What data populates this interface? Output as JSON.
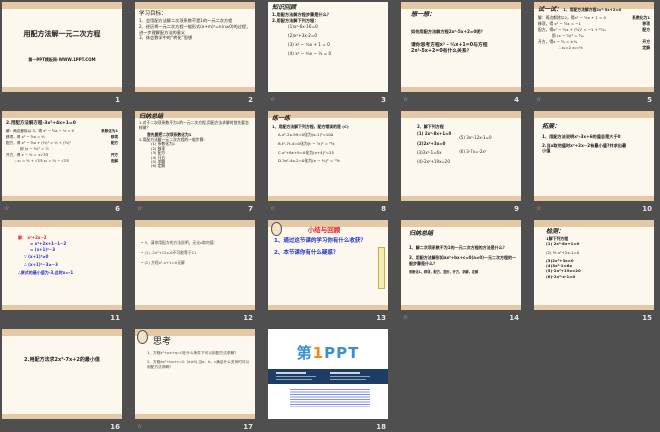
{
  "slides": [
    {
      "number": "1",
      "title": "用配方法解一元二次方程",
      "footer": "第一PPT模板网-WWW.1PPT.COM"
    },
    {
      "number": "2",
      "heading": "学习目标：",
      "lines": [
        "1、会用配方法解二次项系数不是1的一元二次方程",
        "2、经历将一元二次方程一般形式(x+m)²=n(n≥0)的过程，进一步理解配方法的意义",
        "3、体会数学中的“转化”思想"
      ]
    },
    {
      "number": "3",
      "heading": "知识回顾",
      "lines": [
        "1.用配方法解方程步骤是什么？",
        "2.用配方法解下列方程：",
        "(1)x²-6x-16=0",
        "(2)x²+3x-2=0",
        "(3) x² − ⁵⁄₂x + 1 = 0",
        "(4) x² − ⁴⁄₃x − ⅓ = 0"
      ]
    },
    {
      "number": "4",
      "heading": "想一想：",
      "lines": [
        "如何用配方法解方程2x²-5x+2=0呢？",
        "请你思考方程x² - ⁵⁄₂x+1=0与方程2x²-5x+2=0有什么关系？"
      ]
    },
    {
      "number": "5",
      "heading": "试一试：",
      "subheading": "1、用配方法解方程2x²-5x+2=0",
      "rows": [
        {
          "text": "解：两边都除以2，得x² − ⁵⁄₂x + 1 = 0",
          "note": "系数化为1"
        },
        {
          "text": "移项，得 x² − ⁵⁄₂x = −1",
          "note": "移项"
        },
        {
          "text": "配方，得x² − ⁵⁄₂x + (⁵⁄₄)² = −1 + ²⁵⁄₁₆",
          "note": "配方"
        },
        {
          "text": "即 (x − ⁵⁄₄)² = ⁹⁄₁₆",
          "note": ""
        },
        {
          "text": "开方，得x − ⁵⁄₄ = ±¾",
          "note": "开方"
        },
        {
          "text": "∴ x₁=2  x₂=½",
          "note": "定解"
        }
      ]
    },
    {
      "number": "6",
      "heading": "2.用配方法解方程-3x²+4x+1=0",
      "rows": [
        {
          "text": "解：两边都除以-3，得 x² − ⁴⁄₃x − ⅓ = 0",
          "note": "系数化为1"
        },
        {
          "text": "移项，得 x² − ⁴⁄₃x = ⅓",
          "note": "移项"
        },
        {
          "text": "配方，得 x² − ⁴⁄₃x + (⅔)² = ⅓ + (⅔)²",
          "note": "配方"
        },
        {
          "text": "即 (x − ⅔)² = ⁷⁄₉",
          "note": ""
        },
        {
          "text": "开方，得 x − ⅔ = ±√7⁄3",
          "note": "开方"
        },
        {
          "text": "∴ x₁ = ⅔ + √7⁄3  x₂ = ⅔ − √7⁄3",
          "note": "定解"
        }
      ]
    },
    {
      "number": "7",
      "heading": "归纳总结",
      "lines": [
        "1.对于二次项系数不为1的一元二次方程,用配方法求解时首先要怎样做？",
        "首先要把二次项系数化为1",
        "2.用配方法解一元二次方程的一般步骤:",
        "(1) 系数化为1",
        "(2) 移项",
        "(3) 配方",
        "(4) 开方",
        "(5) 求解",
        "(6) 定解"
      ]
    },
    {
      "number": "8",
      "heading": "练一练",
      "lines": [
        "1、用配方法解下列方程，配方错误的是 (C)",
        "A.x²-2x-99=0化为(x-1)²=100",
        "B.t²-7t-4=0化为(t − ⁷⁄₂)² = ⁶⁵⁄₄",
        "C.x²+8x+9=0化为(x+4)²=25",
        "D.3x²-4x-2=0化为(x − ⅔)² = ¹⁰⁄₉"
      ]
    },
    {
      "number": "9",
      "heading": "2、解下列方程",
      "left": [
        "(1) 2x²-8x+1=0",
        "(2)2x²+3x=0",
        "(3)3x²-1=6x",
        "(4)-2x²+19x=20"
      ],
      "right": [
        "(5) 3x²-12x-1=0",
        "(6) 3-7x=-2x²"
      ]
    },
    {
      "number": "10",
      "heading": "拓展：",
      "lines": [
        "1、用配方法说明x²-3x+6的值总是大于0",
        "2.当x取何值时x²+2x−2有最小值?并求出最小值"
      ]
    },
    {
      "number": "11",
      "label": "解：",
      "lines": [
        "x²+2x−2",
        "= x²+2x+1−1−2",
        "= (x+1)²−3",
        "∵ (x+1)²≥0",
        "∴ (x+1)²−3≥−3",
        "∴原式的最小值为-3,此时x=-1"
      ]
    },
    {
      "number": "12",
      "lines": [
        "• 3、请你用配方的方法说明，无论x取何值：",
        "• (1) -2x²+12x-8不可能等于11",
        "• (2) 方程x²-x+1=0无解"
      ]
    },
    {
      "number": "13",
      "heading": "小结与回顾",
      "lines": [
        "1、通过这节课的学习你有什么收获？",
        "2、本节课你有什么疑惑？"
      ]
    },
    {
      "number": "14",
      "heading": "归纳总结",
      "lines": [
        "1、解二次项系数不为1的一元二次方程的方法是什么？",
        "2、用配方法解形如ax²+bx+c=0(a≠0)一元二次方程的一般步骤是什么？",
        "系数化1，移项，配方，变形，开方，求解，定解"
      ]
    },
    {
      "number": "15",
      "heading": "检测：",
      "lines": [
        "1解下列方程",
        "(1) 2x²-8x+1=0",
        "(2) ½ x²+2x-1=0",
        "(3)2x²+3x=0",
        "(4)3x²-1=6x",
        "(5)-2x²+19x=20",
        "(6)-2x²-x-1=0"
      ]
    },
    {
      "number": "16",
      "title": "2.用配方法求2x²-7x+2的最小值"
    },
    {
      "number": "17",
      "heading": "思考",
      "lines": [
        "1、方程x²+px+q=0在什么条件下可以用配方法求解？",
        "2、方程ax²+bx+c=0（a≠0),当a、b、c满足什么关系时可以用配方法求解?"
      ]
    },
    {
      "number": "18",
      "logo": "第1PPT"
    }
  ],
  "colors": {
    "background": "#4f4f4f",
    "slide": "#fcf8ee",
    "band": "#e5c9a6",
    "accent_blue": "#2233cc",
    "accent_red": "#e02020"
  },
  "animation_icon": "animation-star-icon"
}
